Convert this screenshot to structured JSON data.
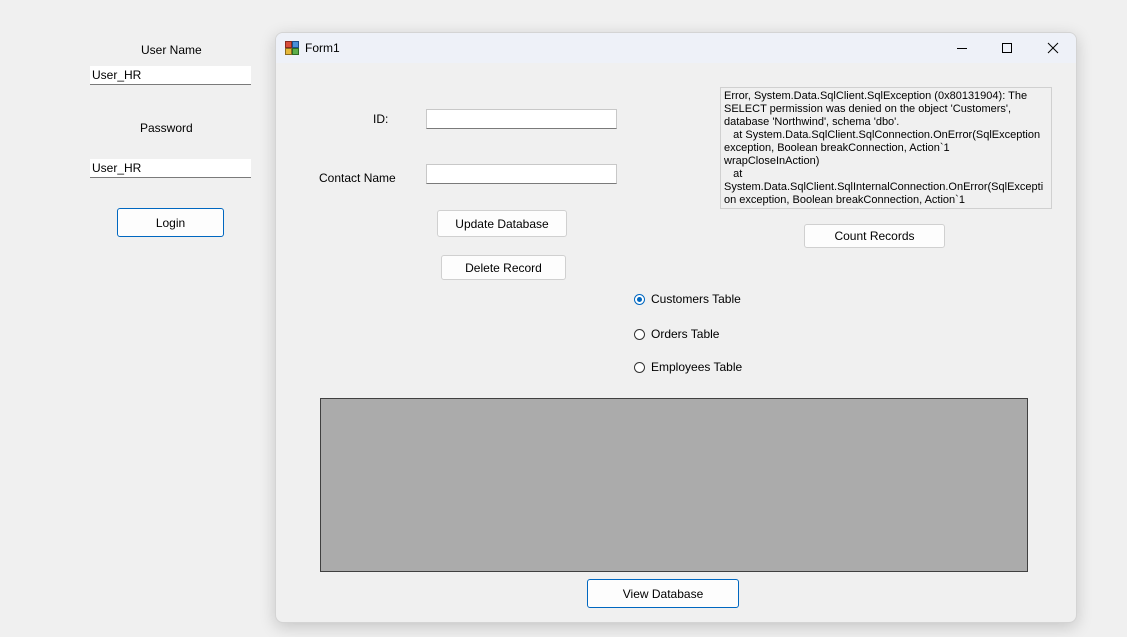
{
  "login_panel": {
    "username_label": "User Name",
    "username_value": "User_HR",
    "password_label": "Password",
    "password_value": "User_HR",
    "login_button": "Login"
  },
  "window": {
    "title": "Form1",
    "app_icon": "winforms-form-icon",
    "controls": {
      "minimize_icon": "minimize-icon",
      "maximize_icon": "maximize-icon",
      "close_icon": "close-icon"
    }
  },
  "form": {
    "id_label": "ID:",
    "id_value": "",
    "contact_name_label": "Contact Name",
    "contact_name_value": "",
    "update_button": "Update Database",
    "delete_button": "Delete Record",
    "count_button": "Count Records",
    "view_button": "View Database",
    "error_text": "Error, System.Data.SqlClient.SqlException (0x80131904): The SELECT permission was denied on the object 'Customers', database 'Northwind', schema 'dbo'.\n   at System.Data.SqlClient.SqlConnection.OnError(SqlException exception, Boolean breakConnection, Action`1 wrapCloseInAction)\n   at System.Data.SqlClient.SqlInternalConnection.OnError(SqlException exception, Boolean breakConnection, Action`1 wrapCloseInAction)\n   at System.Data.SqlClient.TdsParser.ThrowExceptionAndWarning",
    "radios": [
      {
        "label": "Customers Table",
        "checked": true
      },
      {
        "label": "Orders Table",
        "checked": false
      },
      {
        "label": "Employees Table",
        "checked": false
      }
    ]
  },
  "colors": {
    "accent": "#0067c0",
    "grid_background": "#ababab",
    "window_background": "#f0f0f0"
  }
}
